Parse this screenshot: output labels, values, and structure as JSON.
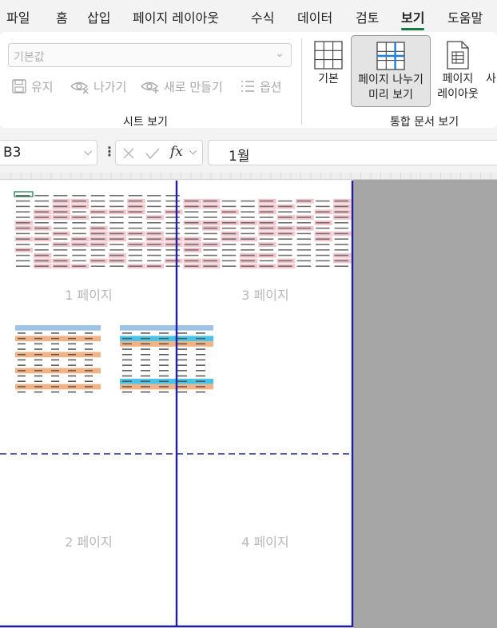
{
  "menu": {
    "tabs": [
      {
        "label": "파일"
      },
      {
        "label": "홈"
      },
      {
        "label": "삽입"
      },
      {
        "label": "페이지 레이아웃"
      },
      {
        "label": "수식"
      },
      {
        "label": "데이터"
      },
      {
        "label": "검토"
      },
      {
        "label": "보기",
        "active": true
      },
      {
        "label": "도움말"
      }
    ]
  },
  "ribbon": {
    "sheet_view": {
      "select_value": "기본값",
      "keep_label": "유지",
      "exit_label": "나가기",
      "new_label": "새로 만들기",
      "options_label": "옵션",
      "group_label": "시트 보기"
    },
    "workbook_views": {
      "normal_label": "기본",
      "page_break_label_line1": "페이지 나누기",
      "page_break_label_line2": "미리 보기",
      "page_layout_label_line1": "페이지",
      "page_layout_label_line2": "레이아웃",
      "custom_partial_label": "사",
      "group_label": "통합 문서 보기"
    }
  },
  "formula_bar": {
    "name_box": "B3",
    "formula": "1월",
    "fx_label": "fx"
  },
  "sheet": {
    "pages": [
      {
        "label": "1 페이지"
      },
      {
        "label": "2 페이지"
      },
      {
        "label": "3 페이지"
      },
      {
        "label": "4 페이지"
      }
    ],
    "colors": {
      "page_border": "#1f1fa3",
      "cell_highlight": "#f6c6cc",
      "table_blue": "#9dc3e6",
      "table_orange": "#f4b183",
      "table_cyan": "#47c4e8",
      "outside_area": "#a6a6a6"
    }
  }
}
